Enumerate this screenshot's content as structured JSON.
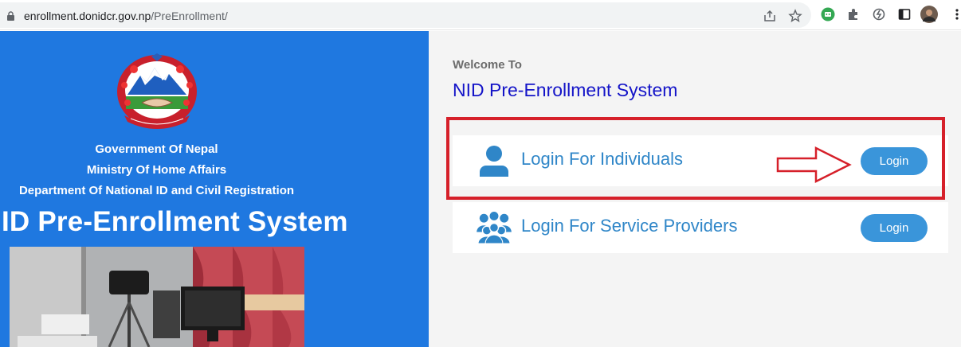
{
  "browser": {
    "url_domain": "enrollment.donidcr.gov.np",
    "url_path": "/PreEnrollment/"
  },
  "left": {
    "gov_line_1": "Government Of Nepal",
    "gov_line_2": "Ministry Of Home Affairs",
    "gov_line_3": "Department Of National ID and Civil Registration",
    "title": "ID Pre-Enrollment System"
  },
  "right": {
    "welcome": "Welcome To",
    "system_title": "NID Pre-Enrollment System",
    "cards": [
      {
        "label": "Login For Individuals",
        "button": "Login"
      },
      {
        "label": "Login For Service Providers",
        "button": "Login"
      }
    ]
  },
  "colors": {
    "left_panel": "#1f78e0",
    "highlight": "#d6202a",
    "button": "#3a95da",
    "title_blue": "#1414c8"
  }
}
